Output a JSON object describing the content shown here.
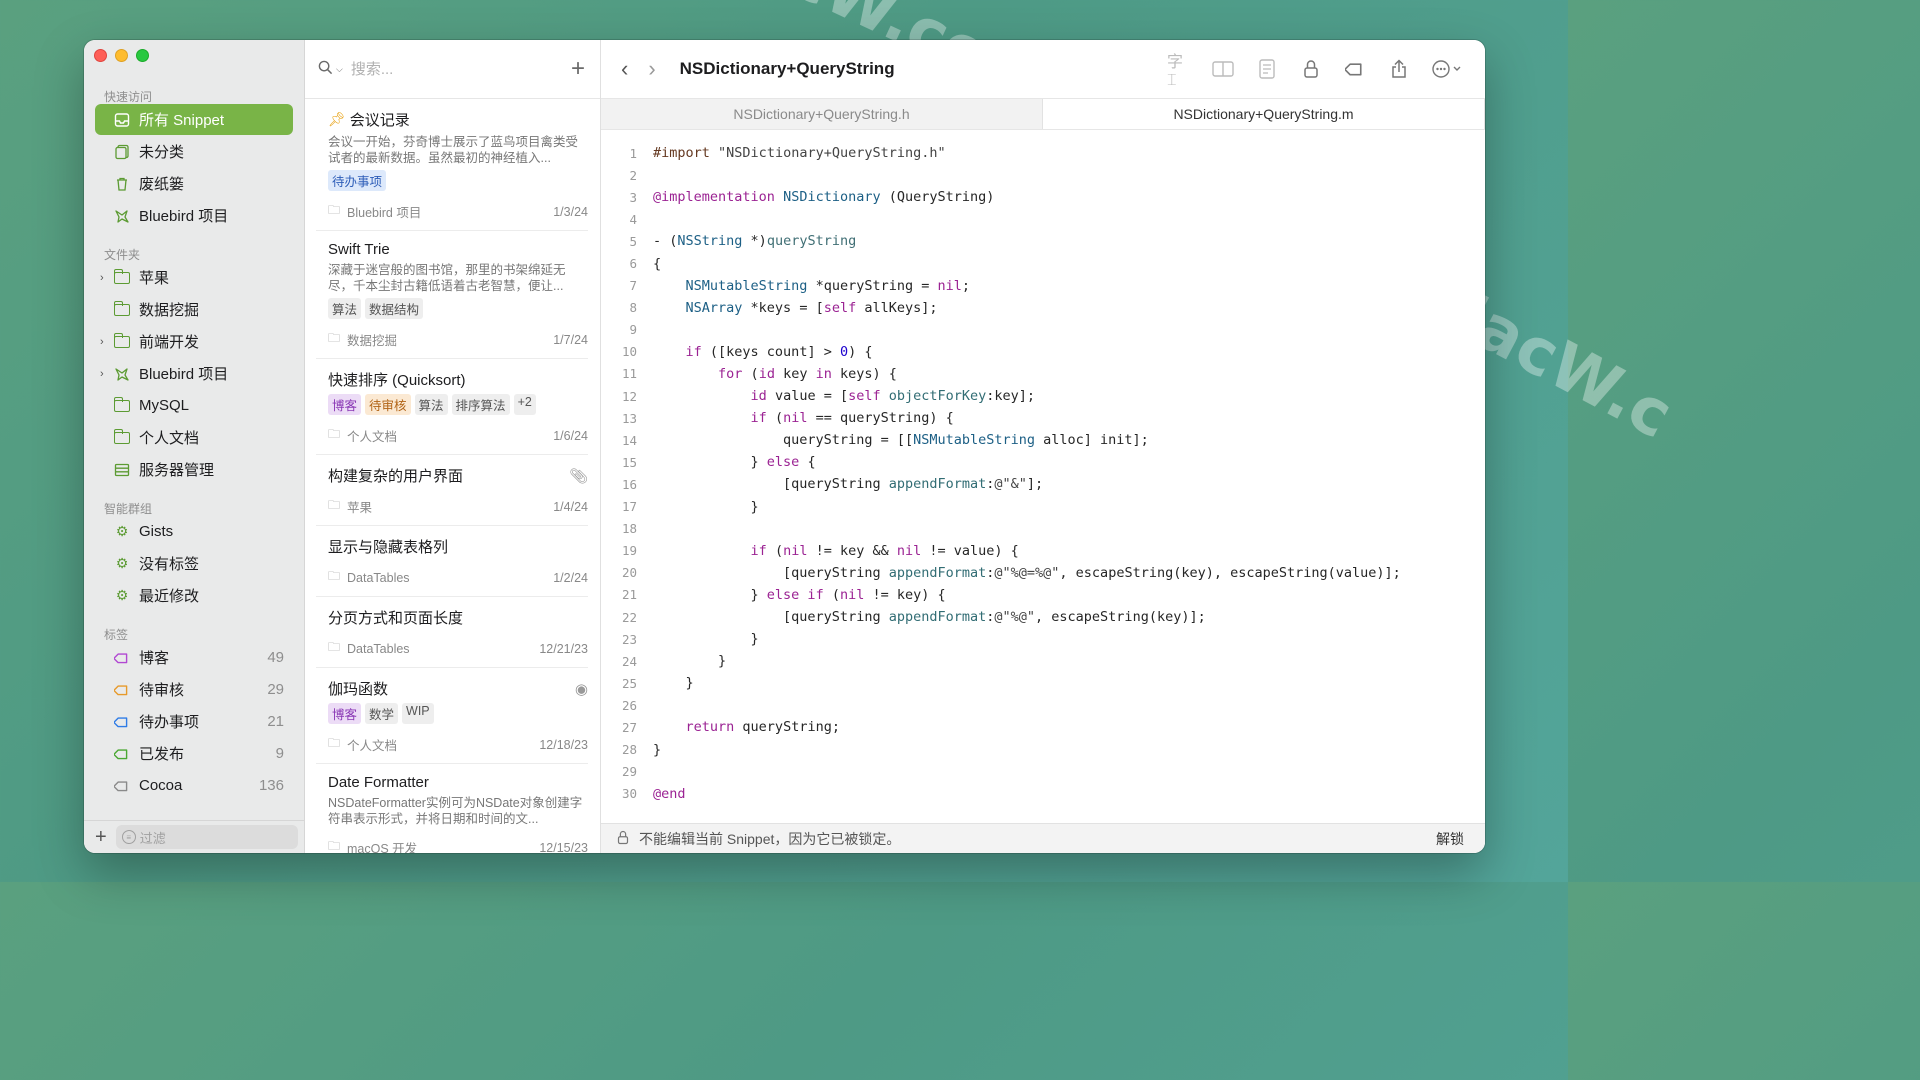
{
  "sidebar": {
    "quick_access_title": "快速访问",
    "quick_items": [
      {
        "label": "所有 Snippet"
      },
      {
        "label": "未分类"
      },
      {
        "label": "废纸篓"
      },
      {
        "label": "Bluebird 项目"
      }
    ],
    "folders_title": "文件夹",
    "folders": [
      {
        "label": "苹果",
        "expandable": true
      },
      {
        "label": "数据挖掘",
        "expandable": false
      },
      {
        "label": "前端开发",
        "expandable": true
      },
      {
        "label": "Bluebird 项目",
        "expandable": true
      },
      {
        "label": "MySQL",
        "expandable": false
      },
      {
        "label": "个人文档",
        "expandable": false
      },
      {
        "label": "服务器管理",
        "expandable": false
      }
    ],
    "smart_title": "智能群组",
    "smart_items": [
      {
        "label": "Gists"
      },
      {
        "label": "没有标签"
      },
      {
        "label": "最近修改"
      }
    ],
    "tags_title": "标签",
    "tags": [
      {
        "label": "博客",
        "count": "49",
        "color": "#b148d2"
      },
      {
        "label": "待审核",
        "count": "29",
        "color": "#e79a2b"
      },
      {
        "label": "待办事项",
        "count": "21",
        "color": "#2f7ce6"
      },
      {
        "label": "已发布",
        "count": "9",
        "color": "#4aa832"
      },
      {
        "label": "Cocoa",
        "count": "136",
        "color": "#8a8a8a"
      }
    ],
    "filter_placeholder": "过滤"
  },
  "list": {
    "search_placeholder": "搜索...",
    "snippets": [
      {
        "title": "会议记录",
        "pinned": true,
        "desc": "会议一开始，芬奇博士展示了蓝鸟项目禽类受试者的最新数据。虽然最初的神经植入...",
        "tags": [
          {
            "label": "待办事项",
            "style": "blue"
          }
        ],
        "folder": "Bluebird 项目",
        "date": "1/3/24"
      },
      {
        "title": "Swift Trie",
        "desc": "深藏于迷宫般的图书馆，那里的书架绵延无尽，千本尘封古籍低语着古老智慧，便让...",
        "tags": [
          {
            "label": "算法",
            "style": ""
          },
          {
            "label": "数据结构",
            "style": ""
          }
        ],
        "folder": "数据挖掘",
        "date": "1/7/24"
      },
      {
        "title": "快速排序 (Quicksort)",
        "desc": "",
        "tags": [
          {
            "label": "博客",
            "style": "purple"
          },
          {
            "label": "待审核",
            "style": "orange"
          },
          {
            "label": "算法",
            "style": ""
          },
          {
            "label": "排序算法",
            "style": ""
          },
          {
            "label": "+2",
            "style": ""
          }
        ],
        "folder": "个人文档",
        "date": "1/6/24"
      },
      {
        "title": "构建复杂的用户界面",
        "desc": "",
        "tags": [],
        "folder": "苹果",
        "date": "1/4/24",
        "badge": "attachment"
      },
      {
        "title": "显示与隐藏表格列",
        "desc": "",
        "tags": [],
        "folder": "DataTables",
        "date": "1/2/24"
      },
      {
        "title": "分页方式和页面长度",
        "desc": "",
        "tags": [],
        "folder": "DataTables",
        "date": "12/21/23"
      },
      {
        "title": "伽玛函数",
        "desc": "",
        "tags": [
          {
            "label": "博客",
            "style": "purple"
          },
          {
            "label": "数学",
            "style": ""
          },
          {
            "label": "WIP",
            "style": ""
          }
        ],
        "folder": "个人文档",
        "date": "12/18/23",
        "badge": "github"
      },
      {
        "title": "Date Formatter",
        "desc": "NSDateFormatter实例可为NSDate对象创建字符串表示形式，并将日期和时间的文...",
        "tags": [],
        "folder": "macOS 开发",
        "date": "12/15/23"
      }
    ],
    "selected_title": "NSDictionary+QueryString"
  },
  "editor": {
    "title": "NSDictionary+QueryString",
    "tabs": [
      {
        "label": "NSDictionary+QueryString.h",
        "active": false
      },
      {
        "label": "NSDictionary+QueryString.m",
        "active": true
      }
    ],
    "status_text": "不能编辑当前 Snippet，因为它已被锁定。",
    "unlock_label": "解锁"
  }
}
